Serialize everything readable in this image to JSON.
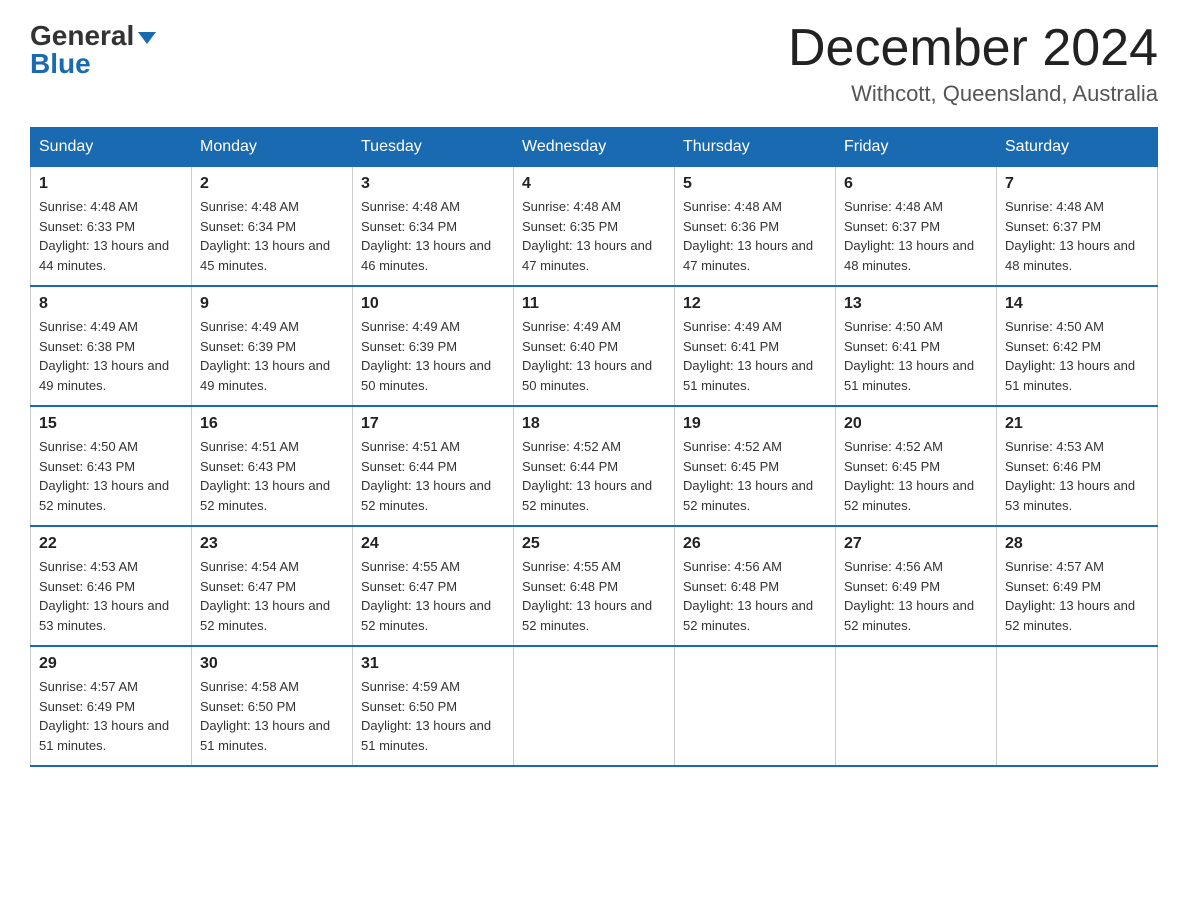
{
  "logo": {
    "general": "General",
    "blue": "Blue",
    "arrow": "▼"
  },
  "title": {
    "month": "December 2024",
    "location": "Withcott, Queensland, Australia"
  },
  "headers": [
    "Sunday",
    "Monday",
    "Tuesday",
    "Wednesday",
    "Thursday",
    "Friday",
    "Saturday"
  ],
  "weeks": [
    [
      {
        "day": "1",
        "sunrise": "4:48 AM",
        "sunset": "6:33 PM",
        "daylight": "13 hours and 44 minutes."
      },
      {
        "day": "2",
        "sunrise": "4:48 AM",
        "sunset": "6:34 PM",
        "daylight": "13 hours and 45 minutes."
      },
      {
        "day": "3",
        "sunrise": "4:48 AM",
        "sunset": "6:34 PM",
        "daylight": "13 hours and 46 minutes."
      },
      {
        "day": "4",
        "sunrise": "4:48 AM",
        "sunset": "6:35 PM",
        "daylight": "13 hours and 47 minutes."
      },
      {
        "day": "5",
        "sunrise": "4:48 AM",
        "sunset": "6:36 PM",
        "daylight": "13 hours and 47 minutes."
      },
      {
        "day": "6",
        "sunrise": "4:48 AM",
        "sunset": "6:37 PM",
        "daylight": "13 hours and 48 minutes."
      },
      {
        "day": "7",
        "sunrise": "4:48 AM",
        "sunset": "6:37 PM",
        "daylight": "13 hours and 48 minutes."
      }
    ],
    [
      {
        "day": "8",
        "sunrise": "4:49 AM",
        "sunset": "6:38 PM",
        "daylight": "13 hours and 49 minutes."
      },
      {
        "day": "9",
        "sunrise": "4:49 AM",
        "sunset": "6:39 PM",
        "daylight": "13 hours and 49 minutes."
      },
      {
        "day": "10",
        "sunrise": "4:49 AM",
        "sunset": "6:39 PM",
        "daylight": "13 hours and 50 minutes."
      },
      {
        "day": "11",
        "sunrise": "4:49 AM",
        "sunset": "6:40 PM",
        "daylight": "13 hours and 50 minutes."
      },
      {
        "day": "12",
        "sunrise": "4:49 AM",
        "sunset": "6:41 PM",
        "daylight": "13 hours and 51 minutes."
      },
      {
        "day": "13",
        "sunrise": "4:50 AM",
        "sunset": "6:41 PM",
        "daylight": "13 hours and 51 minutes."
      },
      {
        "day": "14",
        "sunrise": "4:50 AM",
        "sunset": "6:42 PM",
        "daylight": "13 hours and 51 minutes."
      }
    ],
    [
      {
        "day": "15",
        "sunrise": "4:50 AM",
        "sunset": "6:43 PM",
        "daylight": "13 hours and 52 minutes."
      },
      {
        "day": "16",
        "sunrise": "4:51 AM",
        "sunset": "6:43 PM",
        "daylight": "13 hours and 52 minutes."
      },
      {
        "day": "17",
        "sunrise": "4:51 AM",
        "sunset": "6:44 PM",
        "daylight": "13 hours and 52 minutes."
      },
      {
        "day": "18",
        "sunrise": "4:52 AM",
        "sunset": "6:44 PM",
        "daylight": "13 hours and 52 minutes."
      },
      {
        "day": "19",
        "sunrise": "4:52 AM",
        "sunset": "6:45 PM",
        "daylight": "13 hours and 52 minutes."
      },
      {
        "day": "20",
        "sunrise": "4:52 AM",
        "sunset": "6:45 PM",
        "daylight": "13 hours and 52 minutes."
      },
      {
        "day": "21",
        "sunrise": "4:53 AM",
        "sunset": "6:46 PM",
        "daylight": "13 hours and 53 minutes."
      }
    ],
    [
      {
        "day": "22",
        "sunrise": "4:53 AM",
        "sunset": "6:46 PM",
        "daylight": "13 hours and 53 minutes."
      },
      {
        "day": "23",
        "sunrise": "4:54 AM",
        "sunset": "6:47 PM",
        "daylight": "13 hours and 52 minutes."
      },
      {
        "day": "24",
        "sunrise": "4:55 AM",
        "sunset": "6:47 PM",
        "daylight": "13 hours and 52 minutes."
      },
      {
        "day": "25",
        "sunrise": "4:55 AM",
        "sunset": "6:48 PM",
        "daylight": "13 hours and 52 minutes."
      },
      {
        "day": "26",
        "sunrise": "4:56 AM",
        "sunset": "6:48 PM",
        "daylight": "13 hours and 52 minutes."
      },
      {
        "day": "27",
        "sunrise": "4:56 AM",
        "sunset": "6:49 PM",
        "daylight": "13 hours and 52 minutes."
      },
      {
        "day": "28",
        "sunrise": "4:57 AM",
        "sunset": "6:49 PM",
        "daylight": "13 hours and 52 minutes."
      }
    ],
    [
      {
        "day": "29",
        "sunrise": "4:57 AM",
        "sunset": "6:49 PM",
        "daylight": "13 hours and 51 minutes."
      },
      {
        "day": "30",
        "sunrise": "4:58 AM",
        "sunset": "6:50 PM",
        "daylight": "13 hours and 51 minutes."
      },
      {
        "day": "31",
        "sunrise": "4:59 AM",
        "sunset": "6:50 PM",
        "daylight": "13 hours and 51 minutes."
      },
      null,
      null,
      null,
      null
    ]
  ],
  "labels": {
    "sunrise": "Sunrise:",
    "sunset": "Sunset:",
    "daylight": "Daylight: "
  }
}
